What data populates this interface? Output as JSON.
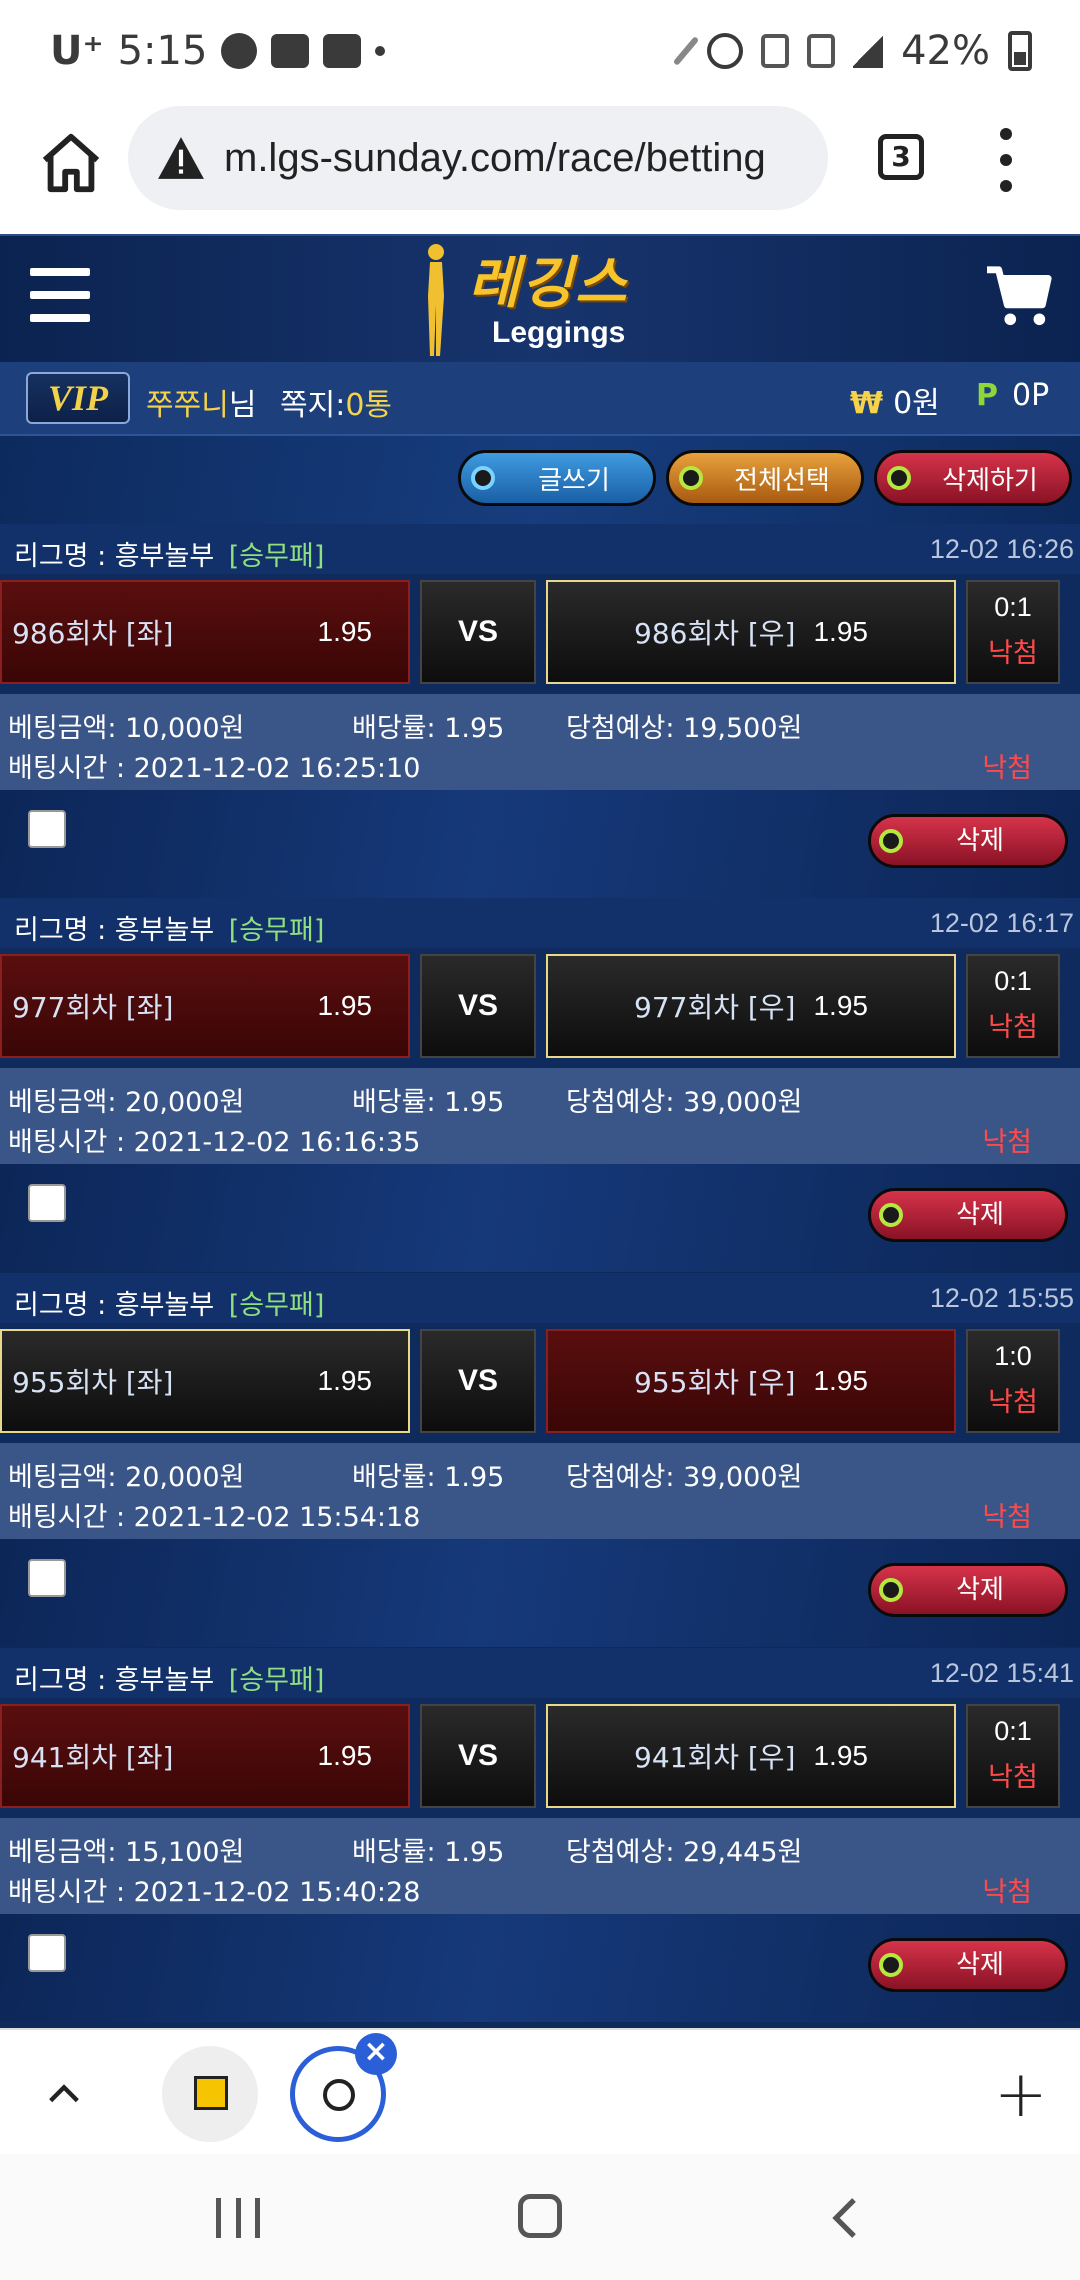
{
  "statusbar": {
    "carrier": "U⁺",
    "time": "5:15",
    "battery": "42%"
  },
  "browser": {
    "url": "m.lgs-sunday.com/race/betting",
    "tab_count": "3"
  },
  "site": {
    "logo_kr": "레깅스",
    "logo_en": "Leggings",
    "user": {
      "level": "VIP",
      "name": "쭈쭈니",
      "suffix": "님",
      "memo_label": "쪽지:",
      "memo_count": "0통",
      "money_symbol": "₩",
      "money": "0원",
      "point_symbol": "P",
      "points": "0P"
    },
    "actions": {
      "write": "글쓰기",
      "select_all": "전체선택",
      "delete": "삭제하기"
    },
    "labels": {
      "league_prefix": "리그명 : ",
      "vs": "VS",
      "amount": "베팅금액:",
      "odds": "배당률:",
      "expected": "당첨예상:",
      "time": "배팅시간 : ",
      "delete": "삭제"
    },
    "bets": [
      {
        "league": "흥부놀부",
        "type": "[승무패]",
        "date": "12-02 16:26",
        "left_team": "986회차 [좌]",
        "left_odd": "1.95",
        "right_team": "986회차 [우]",
        "right_odd": "1.95",
        "score": "0:1",
        "status": "낙첨",
        "amount": "10,000원",
        "odds": "1.95",
        "expected": "19,500원",
        "bet_time": "2021-12-02 16:25:10",
        "result": "낙첨"
      },
      {
        "league": "흥부놀부",
        "type": "[승무패]",
        "date": "12-02 16:17",
        "left_team": "977회차 [좌]",
        "left_odd": "1.95",
        "right_team": "977회차 [우]",
        "right_odd": "1.95",
        "score": "0:1",
        "status": "낙첨",
        "amount": "20,000원",
        "odds": "1.95",
        "expected": "39,000원",
        "bet_time": "2021-12-02 16:16:35",
        "result": "낙첨"
      },
      {
        "league": "흥부놀부",
        "type": "[승무패]",
        "date": "12-02 15:55",
        "left_team": "955회차 [좌]",
        "left_odd": "1.95",
        "right_team": "955회차 [우]",
        "right_odd": "1.95",
        "score": "1:0",
        "status": "낙첨",
        "amount": "20,000원",
        "odds": "1.95",
        "expected": "39,000원",
        "bet_time": "2021-12-02 15:54:18",
        "result": "낙첨"
      },
      {
        "league": "흥부놀부",
        "type": "[승무패]",
        "date": "12-02 15:41",
        "left_team": "941회차 [좌]",
        "left_odd": "1.95",
        "right_team": "941회차 [우]",
        "right_odd": "1.95",
        "score": "0:1",
        "status": "낙첨",
        "amount": "15,100원",
        "odds": "1.95",
        "expected": "29,445원",
        "bet_time": "2021-12-02 15:40:28",
        "result": "낙첨"
      }
    ]
  },
  "tabstrip": {
    "plus": "+"
  }
}
